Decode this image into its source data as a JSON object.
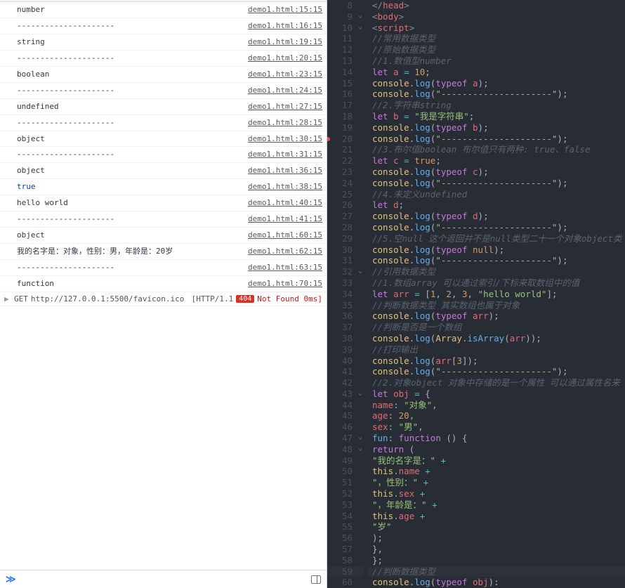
{
  "console": {
    "rows": [
      {
        "msg": "number",
        "src": "demo1.html:15:15"
      },
      {
        "msg": "---------------------",
        "src": "demo1.html:16:15"
      },
      {
        "msg": "string",
        "src": "demo1.html:19:15"
      },
      {
        "msg": "---------------------",
        "src": "demo1.html:20:15"
      },
      {
        "msg": "boolean",
        "src": "demo1.html:23:15"
      },
      {
        "msg": "---------------------",
        "src": "demo1.html:24:15"
      },
      {
        "msg": "undefined",
        "src": "demo1.html:27:15"
      },
      {
        "msg": "---------------------",
        "src": "demo1.html:28:15"
      },
      {
        "msg": "object",
        "src": "demo1.html:30:15"
      },
      {
        "msg": "---------------------",
        "src": "demo1.html:31:15"
      },
      {
        "msg": "object",
        "src": "demo1.html:36:15"
      },
      {
        "msg": "true",
        "cls": "true",
        "src": "demo1.html:38:15"
      },
      {
        "msg": "hello world",
        "src": "demo1.html:40:15"
      },
      {
        "msg": "---------------------",
        "src": "demo1.html:41:15"
      },
      {
        "msg": "object",
        "src": "demo1.html:60:15"
      },
      {
        "msg": "我的名字是：对象，性别：男，年龄是：20岁",
        "src": "demo1.html:62:15"
      },
      {
        "msg": "---------------------",
        "src": "demo1.html:63:15"
      },
      {
        "msg": "function",
        "src": "demo1.html:70:15"
      }
    ],
    "net": {
      "method": "GET",
      "url": "http://127.0.0.1:5500/favicon.ico",
      "proto": "[HTTP/1.1",
      "code": "404",
      "text": "Not Found 0ms]"
    },
    "prompt": "≫"
  },
  "editor": {
    "lines": [
      {
        "n": 8,
        "i": 1,
        "h": "<span class='br'>&lt;/</span><span class='tag'>head</span><span class='br'>&gt;</span>"
      },
      {
        "n": 9,
        "i": 1,
        "fold": "v",
        "h": "<span class='br'>&lt;</span><span class='tag'>body</span><span class='br'>&gt;</span>"
      },
      {
        "n": 10,
        "i": 2,
        "fold": "v",
        "h": "<span class='br'>&lt;</span><span class='tag'>script</span><span class='br'>&gt;</span>"
      },
      {
        "n": 11,
        "i": 3,
        "h": "<span class='cm'>//常用数据类型</span>"
      },
      {
        "n": 12,
        "i": 3,
        "h": "<span class='cm'>//原始数据类型</span>"
      },
      {
        "n": 13,
        "i": 3,
        "h": "<span class='cm'>//1.数值型number</span>"
      },
      {
        "n": 14,
        "i": 3,
        "h": "<span class='kw'>let</span> <span class='var'>a</span> <span class='op'>=</span> <span class='num'>10</span><span class='p'>;</span>"
      },
      {
        "n": 15,
        "i": 3,
        "h": "<span class='obj'>console</span><span class='p'>.</span><span class='fn'>log</span><span class='p'>(</span><span class='kw'>typeof</span> <span class='var'>a</span><span class='p'>);</span>"
      },
      {
        "n": 16,
        "i": 3,
        "h": "<span class='obj'>console</span><span class='p'>.</span><span class='fn'>log</span><span class='p'>(</span><span class='str'>\"---------------------\"</span><span class='p'>);</span>"
      },
      {
        "n": 17,
        "i": 3,
        "h": "<span class='cm'>//2.字符串string</span>"
      },
      {
        "n": 18,
        "i": 3,
        "h": "<span class='kw'>let</span> <span class='var'>b</span> <span class='op'>=</span> <span class='str'>\"我是字符串\"</span><span class='p'>;</span>"
      },
      {
        "n": 19,
        "i": 3,
        "h": "<span class='obj'>console</span><span class='p'>.</span><span class='fn'>log</span><span class='p'>(</span><span class='kw'>typeof</span> <span class='var'>b</span><span class='p'>);</span>"
      },
      {
        "n": 20,
        "i": 3,
        "bp": true,
        "h": "<span class='obj'>console</span><span class='p'>.</span><span class='fn'>log</span><span class='p'>(</span><span class='str'>\"---------------------\"</span><span class='p'>);</span>"
      },
      {
        "n": 21,
        "i": 3,
        "h": "<span class='cm'>//3.布尔值boolean 布尔值只有两种: true、false</span>"
      },
      {
        "n": 22,
        "i": 3,
        "h": "<span class='kw'>let</span> <span class='var'>c</span> <span class='op'>=</span> <span class='bool'>true</span><span class='p'>;</span>"
      },
      {
        "n": 23,
        "i": 3,
        "h": "<span class='obj'>console</span><span class='p'>.</span><span class='fn'>log</span><span class='p'>(</span><span class='kw'>typeof</span> <span class='var'>c</span><span class='p'>);</span>"
      },
      {
        "n": 24,
        "i": 3,
        "h": "<span class='obj'>console</span><span class='p'>.</span><span class='fn'>log</span><span class='p'>(</span><span class='str'>\"---------------------\"</span><span class='p'>);</span>"
      },
      {
        "n": 25,
        "i": 3,
        "h": "<span class='cm'>//4.未定义undefined</span>"
      },
      {
        "n": 26,
        "i": 3,
        "h": "<span class='kw'>let</span> <span class='var'>d</span><span class='p'>;</span>"
      },
      {
        "n": 27,
        "i": 3,
        "h": "<span class='obj'>console</span><span class='p'>.</span><span class='fn'>log</span><span class='p'>(</span><span class='kw'>typeof</span> <span class='var'>d</span><span class='p'>);</span>"
      },
      {
        "n": 28,
        "i": 3,
        "h": "<span class='obj'>console</span><span class='p'>.</span><span class='fn'>log</span><span class='p'>(</span><span class='str'>\"---------------------\"</span><span class='p'>);</span>"
      },
      {
        "n": 29,
        "i": 3,
        "h": "<span class='cm'>//5.空null 这个返回并不是null类型二十一个对象object类</span>"
      },
      {
        "n": 30,
        "i": 3,
        "h": "<span class='obj'>console</span><span class='p'>.</span><span class='fn'>log</span><span class='p'>(</span><span class='kw'>typeof</span> <span class='bool'>null</span><span class='p'>);</span>"
      },
      {
        "n": 31,
        "i": 3,
        "h": "<span class='obj'>console</span><span class='p'>.</span><span class='fn'>log</span><span class='p'>(</span><span class='str'>\"---------------------\"</span><span class='p'>);</span>"
      },
      {
        "n": 32,
        "i": 3,
        "fold": "v",
        "h": "<span class='cm'>//引用数据类型</span>"
      },
      {
        "n": 33,
        "i": 3,
        "h": "<span class='cm'>//1.数组array 可以通过索引/下标来取数组中的值</span>"
      },
      {
        "n": 34,
        "i": 3,
        "h": "<span class='kw'>let</span> <span class='var'>arr</span> <span class='op'>=</span> <span class='p'>[</span><span class='num'>1</span><span class='p'>, </span><span class='num'>2</span><span class='p'>, </span><span class='num'>3</span><span class='p'>, </span><span class='str'>\"hello world\"</span><span class='p'>];</span>"
      },
      {
        "n": 35,
        "i": 3,
        "h": "<span class='cm'>//判断数据类型 其实数组也属于对象</span>"
      },
      {
        "n": 36,
        "i": 3,
        "h": "<span class='obj'>console</span><span class='p'>.</span><span class='fn'>log</span><span class='p'>(</span><span class='kw'>typeof</span> <span class='var'>arr</span><span class='p'>);</span>"
      },
      {
        "n": 37,
        "i": 3,
        "h": "<span class='cm'>//判断是否是一个数组</span>"
      },
      {
        "n": 38,
        "i": 3,
        "h": "<span class='obj'>console</span><span class='p'>.</span><span class='fn'>log</span><span class='p'>(</span><span class='obj'>Array</span><span class='p'>.</span><span class='fn'>isArray</span><span class='p'>(</span><span class='var'>arr</span><span class='p'>));</span>"
      },
      {
        "n": 39,
        "i": 3,
        "h": "<span class='cm'>//打印输出</span>"
      },
      {
        "n": 40,
        "i": 3,
        "h": "<span class='obj'>console</span><span class='p'>.</span><span class='fn'>log</span><span class='p'>(</span><span class='var'>arr</span><span class='p'>[</span><span class='num'>3</span><span class='p'>]);</span>"
      },
      {
        "n": 41,
        "i": 3,
        "h": "<span class='obj'>console</span><span class='p'>.</span><span class='fn'>log</span><span class='p'>(</span><span class='str'>\"---------------------\"</span><span class='p'>);</span>"
      },
      {
        "n": 42,
        "i": 3,
        "h": "<span class='cm'>//2.对象object 对象中存储的是一个属性 可以通过属性名来</span>"
      },
      {
        "n": 43,
        "i": 3,
        "fold": "v",
        "h": "<span class='kw'>let</span> <span class='var'>obj</span> <span class='op'>=</span> <span class='p'>{</span>"
      },
      {
        "n": 44,
        "i": 4,
        "h": "<span class='prop'>name</span><span class='p'>: </span><span class='str'>\"对象\"</span><span class='p'>,</span>"
      },
      {
        "n": 45,
        "i": 4,
        "h": "<span class='prop'>age</span><span class='p'>: </span><span class='num'>20</span><span class='p'>,</span>"
      },
      {
        "n": 46,
        "i": 4,
        "h": "<span class='prop'>sex</span><span class='p'>: </span><span class='str'>\"男\"</span><span class='p'>,</span>"
      },
      {
        "n": 47,
        "i": 4,
        "fold": "v",
        "h": "<span class='fn'>fun</span><span class='p'>: </span><span class='kw'>function</span> <span class='p'>() {</span>"
      },
      {
        "n": 48,
        "i": 5,
        "fold": "v",
        "h": "<span class='kw'>return</span> <span class='p'>(</span>"
      },
      {
        "n": 49,
        "i": 6,
        "h": "<span class='str'>\"我的名字是：\"</span> <span class='op'>+</span>"
      },
      {
        "n": 50,
        "i": 6,
        "h": "<span class='obj'>this</span><span class='p'>.</span><span class='var'>name</span> <span class='op'>+</span>"
      },
      {
        "n": 51,
        "i": 6,
        "h": "<span class='str'>\"，性别：\"</span> <span class='op'>+</span>"
      },
      {
        "n": 52,
        "i": 6,
        "h": "<span class='obj'>this</span><span class='p'>.</span><span class='var'>sex</span> <span class='op'>+</span>"
      },
      {
        "n": 53,
        "i": 6,
        "h": "<span class='str'>\"，年龄是：\"</span> <span class='op'>+</span>"
      },
      {
        "n": 54,
        "i": 6,
        "h": "<span class='obj'>this</span><span class='p'>.</span><span class='var'>age</span> <span class='op'>+</span>"
      },
      {
        "n": 55,
        "i": 6,
        "h": "<span class='str'>\"岁\"</span>"
      },
      {
        "n": 56,
        "i": 5,
        "h": "<span class='p'>);</span>"
      },
      {
        "n": 57,
        "i": 4,
        "h": "<span class='p'>},</span>"
      },
      {
        "n": 58,
        "i": 3,
        "h": "<span class='p'>};</span>"
      },
      {
        "n": 59,
        "i": 3,
        "hl": true,
        "h": "<span class='cm'>//判断数据类型</span>"
      },
      {
        "n": 60,
        "i": 3,
        "h": "<span class='obj'>console</span><span class='p'>.</span><span class='fn'>log</span><span class='p'>(</span><span class='kw'>typeof</span> <span class='var'>obj</span><span class='p'>):</span>"
      }
    ]
  }
}
